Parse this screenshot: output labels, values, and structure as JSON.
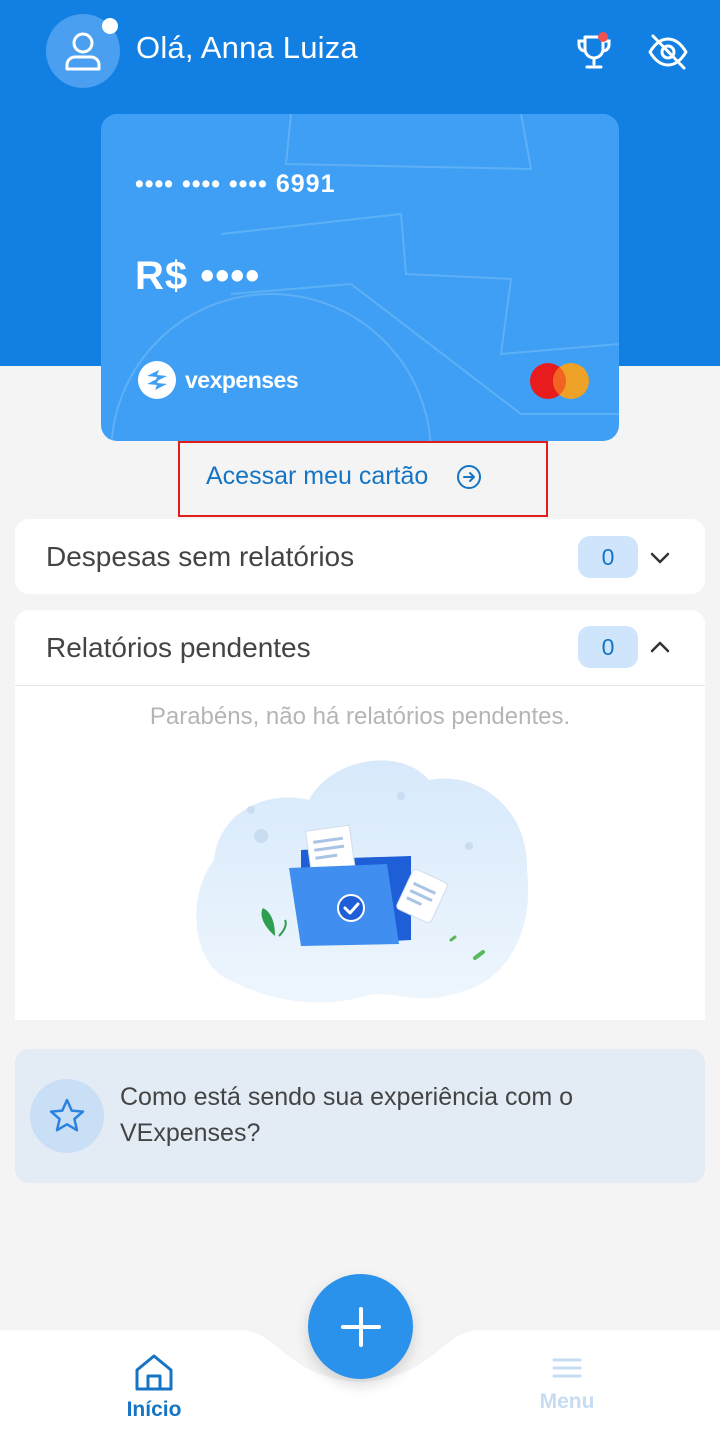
{
  "header": {
    "greeting": "Olá, Anna Luiza",
    "icons": [
      "user-icon",
      "trophy-icon",
      "eye-off-icon"
    ]
  },
  "card": {
    "number_masked": "•••• •••• •••• 6991",
    "balance_masked": "R$ ••••",
    "brand_name": "vexpenses",
    "network": "mastercard-logo"
  },
  "access_card": {
    "label": "Acessar meu cartão"
  },
  "sections": {
    "expenses_without_reports": {
      "title": "Despesas sem relatórios",
      "count": "0"
    },
    "pending_reports": {
      "title": "Relatórios pendentes",
      "count": "0",
      "empty_message": "Parabéns, não há relatórios pendentes."
    }
  },
  "feedback": {
    "text": "Como está sendo sua experiência com o VExpenses?"
  },
  "bottom_nav": {
    "home_label": "Início",
    "menu_label": "Menu"
  },
  "colors": {
    "primary": "#1280e2",
    "card": "#3f9ff4",
    "link": "#1574c4",
    "highlight_border": "#e21b1b"
  }
}
